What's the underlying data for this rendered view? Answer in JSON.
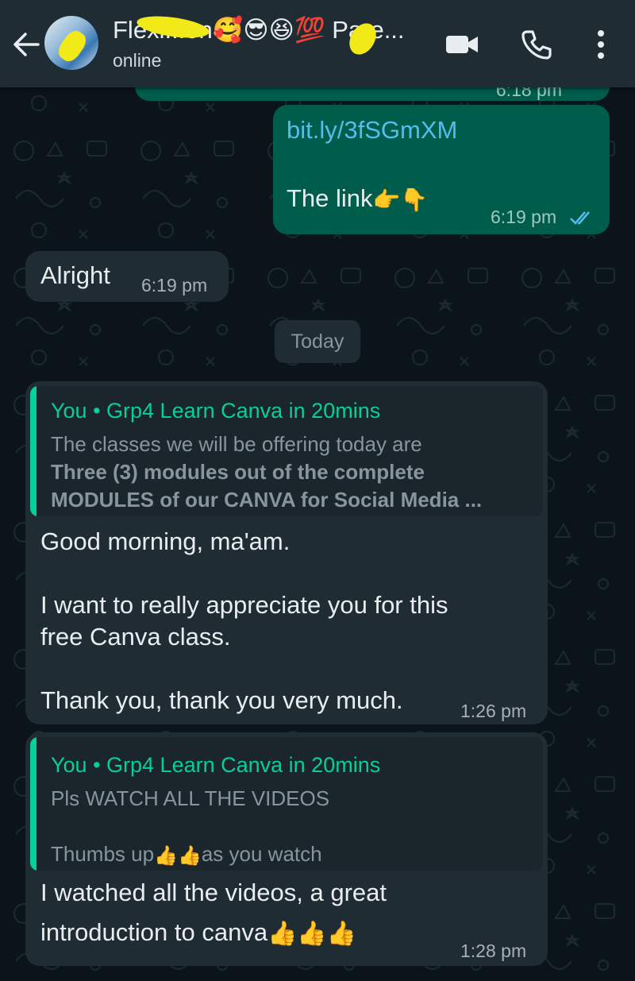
{
  "header": {
    "contact_name": "Flexi...on🥰😎😆💯 Pare...",
    "status": "online",
    "icons": [
      "back-arrow-icon",
      "avatar",
      "video-call-icon",
      "phone-icon",
      "more-options-icon"
    ]
  },
  "messages": [
    {
      "id": "m0",
      "direction": "out",
      "time": "6:18 pm"
    },
    {
      "id": "m1",
      "direction": "out",
      "link": "bit.ly/3fSGmXM",
      "text": "The link",
      "emoji": "👉👇",
      "time": "6:19 pm",
      "ticks": "read"
    },
    {
      "id": "m2",
      "direction": "in",
      "text": "Alright",
      "time": "6:19 pm"
    }
  ],
  "day_divider": "Today",
  "replies": [
    {
      "quote_author": "You",
      "quote_group": "Grp4 Learn Canva in 20mins",
      "quote_lines": [
        "The classes we will be offering today are",
        "Three (3) modules out of the complete",
        "MODULES  of our CANVA for Social Media ..."
      ],
      "lines": [
        "Good morning, ma'am.",
        "I want to really appreciate you for this",
        "free Canva class.",
        "Thank you, thank you very much."
      ],
      "time": "1:26 pm"
    },
    {
      "quote_author": "You",
      "quote_group": "Grp4 Learn Canva in 20mins",
      "quote_lines": [
        "Pls WATCH ALL THE VIDEOS",
        "Thumbs up",
        "as you watch"
      ],
      "lines": [
        "I watched all the videos, a great",
        "introduction to canva"
      ],
      "time": "1:28 pm"
    }
  ],
  "colors": {
    "header": "#1f2c34",
    "outgoing": "#005c4b",
    "incoming": "#1f2c34",
    "accent": "#06cf9c",
    "link": "#53bdeb",
    "background": "#0b141a"
  }
}
